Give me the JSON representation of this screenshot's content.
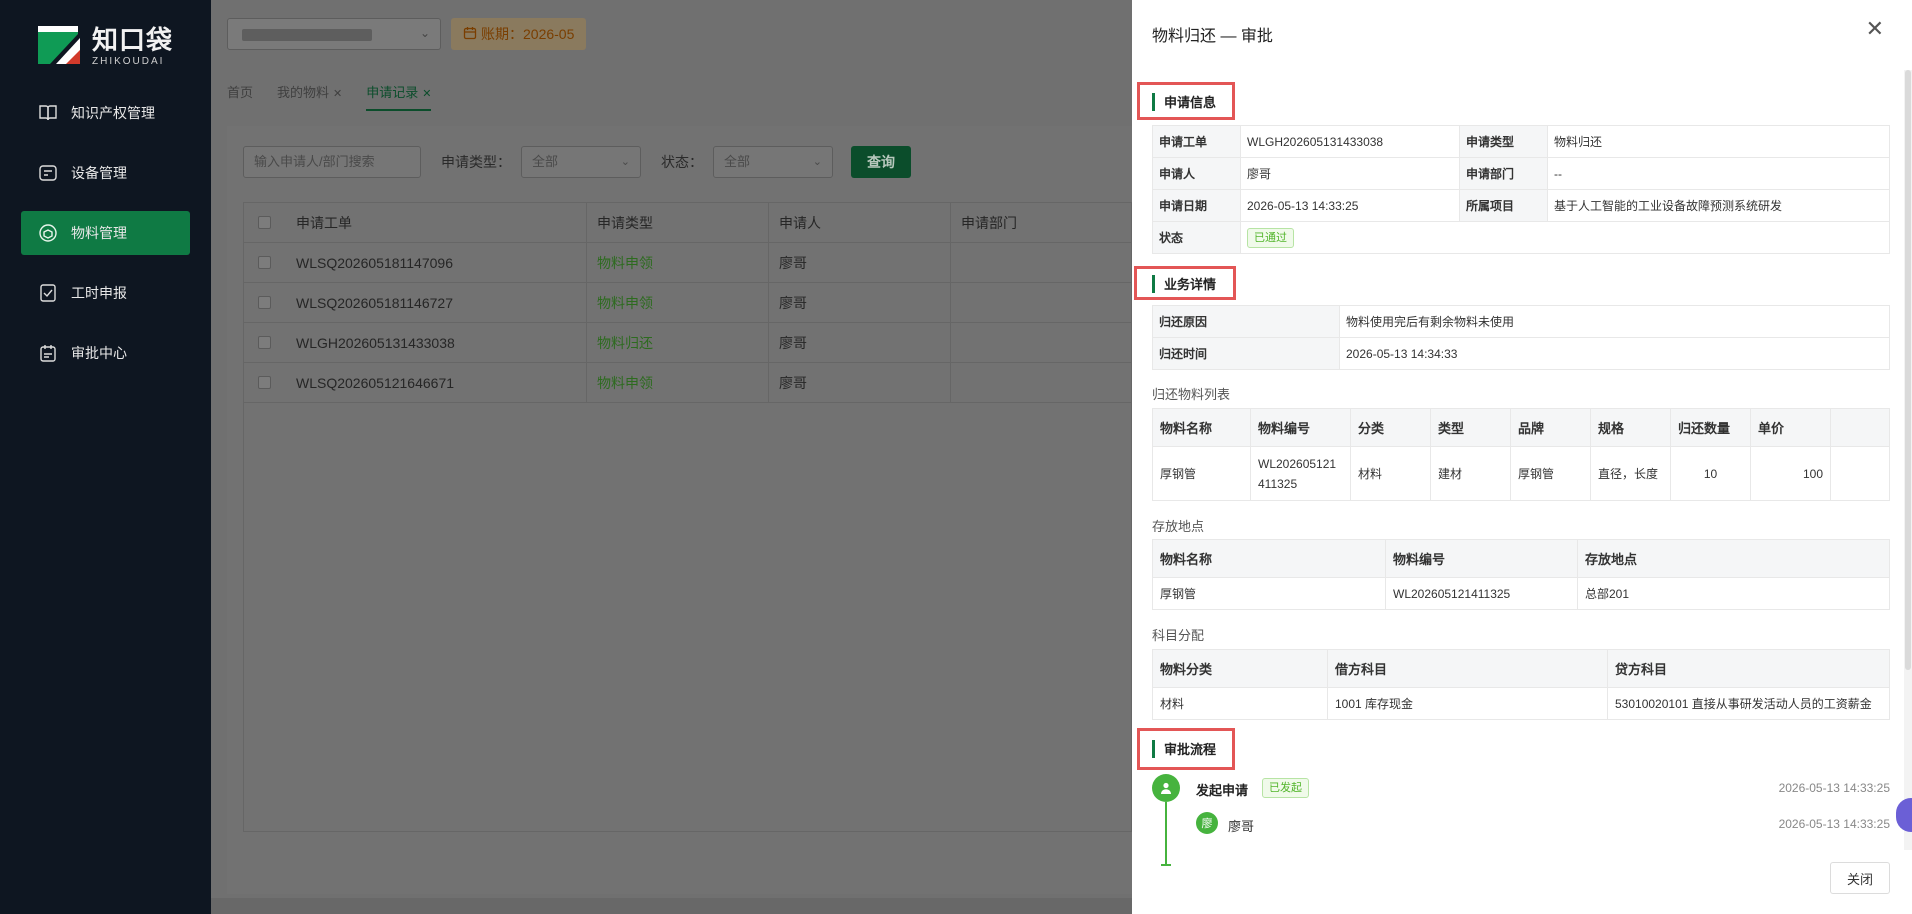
{
  "brand": {
    "name_cn": "知口袋",
    "name_en": "ZHIKOUDAI"
  },
  "sidebar": {
    "items": [
      {
        "label": "知识产权管理",
        "icon": "book-icon"
      },
      {
        "label": "设备管理",
        "icon": "device-icon"
      },
      {
        "label": "物料管理",
        "icon": "box-icon",
        "active": true
      },
      {
        "label": "工时申报",
        "icon": "timesheet-icon"
      },
      {
        "label": "审批中心",
        "icon": "approval-icon"
      }
    ]
  },
  "topbar": {
    "period_label": "账期：2026-05"
  },
  "tabs": [
    {
      "label": "首页"
    },
    {
      "label": "我的物料"
    },
    {
      "label": "申请记录"
    }
  ],
  "filters": {
    "search_placeholder": "输入申请人/部门搜索",
    "type_label": "申请类型：",
    "type_value": "全部",
    "status_label": "状态：",
    "status_value": "全部",
    "query_button": "查询"
  },
  "list": {
    "headers": [
      "申请工单",
      "申请类型",
      "申请人",
      "申请部门"
    ],
    "rows": [
      {
        "order": "WLSQ202605181147096",
        "type": "物料申领",
        "applicant": "廖哥"
      },
      {
        "order": "WLSQ202605181146727",
        "type": "物料申领",
        "applicant": "廖哥"
      },
      {
        "order": "WLGH202605131433038",
        "type": "物料归还",
        "applicant": "廖哥"
      },
      {
        "order": "WLSQ202605121646671",
        "type": "物料申领",
        "applicant": "廖哥"
      }
    ]
  },
  "drawer": {
    "title": "物料归还 — 审批",
    "close_button": "关闭",
    "apply_info": {
      "heading": "申请信息",
      "order_label": "申请工单",
      "order": "WLGH202605131433038",
      "type_label": "申请类型",
      "type": "物料归还",
      "applicant_label": "申请人",
      "applicant": "廖哥",
      "dept_label": "申请部门",
      "dept": "--",
      "date_label": "申请日期",
      "date": "2026-05-13 14:33:25",
      "project_label": "所属项目",
      "project": "基于人工智能的工业设备故障预测系统研发",
      "status_label": "状态",
      "status": "已通过"
    },
    "business": {
      "heading": "业务详情",
      "reason_label": "归还原因",
      "reason": "物料使用完后有剩余物料未使用",
      "time_label": "归还时间",
      "time": "2026-05-13 14:34:33"
    },
    "return_list": {
      "label": "归还物料列表",
      "headers": [
        "物料名称",
        "物料编号",
        "分类",
        "类型",
        "品牌",
        "规格",
        "归还数量",
        "单价"
      ],
      "row": {
        "name": "厚钢管",
        "code_line1": "WL202605121",
        "code_line2": "411325",
        "category": "材料",
        "type": "建材",
        "brand": "厚钢管",
        "spec": "直径，长度",
        "qty": "10",
        "price": "100"
      }
    },
    "storage": {
      "label": "存放地点",
      "headers": [
        "物料名称",
        "物料编号",
        "存放地点"
      ],
      "row": {
        "name": "厚钢管",
        "code": "WL202605121411325",
        "location": "总部201"
      }
    },
    "accounts": {
      "label": "科目分配",
      "headers": [
        "物料分类",
        "借方科目",
        "贷方科目"
      ],
      "row": {
        "category": "材料",
        "debit": "1001 库存现金",
        "credit": "53010020101 直接从事研发活动人员的工资薪金"
      }
    },
    "flow": {
      "heading": "审批流程",
      "step_title": "发起申请",
      "step_tag": "已发起",
      "step_time": "2026-05-13 14:33:25",
      "person_avatar": "廖",
      "person": "廖哥",
      "person_time": "2026-05-13 14:33:25"
    }
  }
}
